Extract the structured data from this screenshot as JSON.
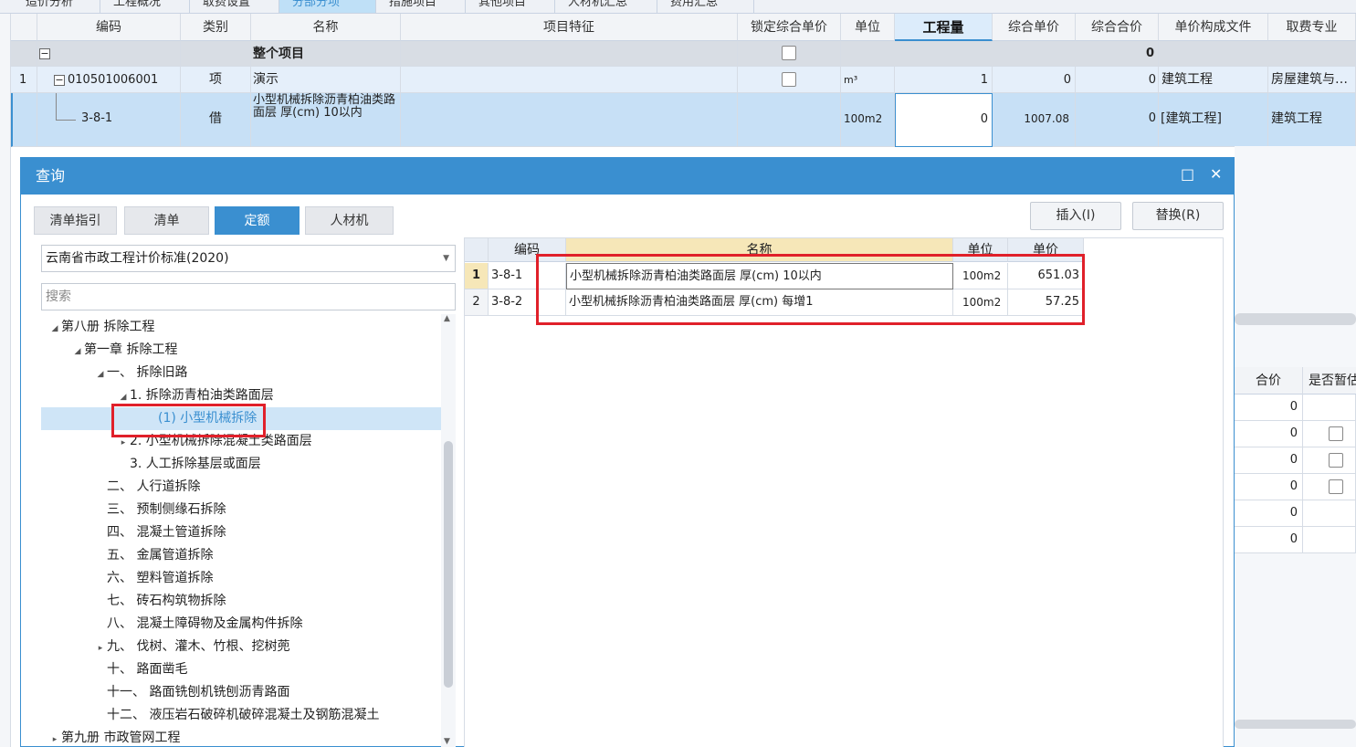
{
  "top_tabs": [
    "造价分析",
    "工程概况",
    "取费设置",
    "分部分项",
    "措施项目",
    "其他项目",
    "人材机汇总",
    "费用汇总"
  ],
  "grid": {
    "headers": [
      "编码",
      "类别",
      "名称",
      "项目特征",
      "锁定综合单价",
      "单位",
      "工程量",
      "综合单价",
      "综合合价",
      "单价构成文件",
      "取费专业"
    ],
    "row0": {
      "name": "整个项目",
      "total": "0",
      "expand": "−"
    },
    "row1": {
      "num": "1",
      "code": "010501006001",
      "type": "项",
      "name": "演示",
      "unit": "m³",
      "qty": "1",
      "price": "0",
      "total": "0",
      "file": "建筑工程",
      "fee": "房屋建筑与…",
      "expand": "−"
    },
    "row2": {
      "code": "3-8-1",
      "type": "借",
      "name": "小型机械拆除沥青柏油类路面层 厚(cm) 10以内",
      "unit": "100m2",
      "qty": "0",
      "price": "1007.08",
      "total": "0",
      "file": "[建筑工程]",
      "fee": "建筑工程"
    }
  },
  "right_panel": {
    "headers": [
      "合价",
      "是否暂估"
    ],
    "values": [
      "0",
      "0",
      "0",
      "0",
      "0",
      "0"
    ]
  },
  "dialog": {
    "title": "查询",
    "maximize_icon": "□",
    "close_icon": "✕",
    "tabs": [
      "清单指引",
      "清单",
      "定额",
      "人材机"
    ],
    "insert_label": "插入(I)",
    "replace_label": "替换(R)",
    "library": "云南省市政工程计价标准(2020)",
    "search_placeholder": "搜索",
    "tree": [
      {
        "label": "第八册 拆除工程",
        "arrow": "◢"
      },
      {
        "label": "第一章 拆除工程",
        "arrow": "◢"
      },
      {
        "label": "一、 拆除旧路",
        "arrow": "◢"
      },
      {
        "label": "1. 拆除沥青柏油类路面层",
        "arrow": "◢"
      },
      {
        "label": "(1) 小型机械拆除",
        "arrow": ""
      },
      {
        "label": "2. 小型机械拆除混凝土类路面层",
        "arrow": "▸"
      },
      {
        "label": "3. 人工拆除基层或面层",
        "arrow": ""
      },
      {
        "label": "二、 人行道拆除",
        "arrow": ""
      },
      {
        "label": "三、 预制侧缘石拆除",
        "arrow": ""
      },
      {
        "label": "四、 混凝土管道拆除",
        "arrow": ""
      },
      {
        "label": "五、 金属管道拆除",
        "arrow": ""
      },
      {
        "label": "六、 塑料管道拆除",
        "arrow": ""
      },
      {
        "label": "七、 砖石构筑物拆除",
        "arrow": ""
      },
      {
        "label": "八、 混凝土障碍物及金属构件拆除",
        "arrow": ""
      },
      {
        "label": "九、 伐树、灌木、竹根、挖树蔸",
        "arrow": "▸"
      },
      {
        "label": "十、 路面凿毛",
        "arrow": ""
      },
      {
        "label": "十一、 路面铣刨机铣刨沥青路面",
        "arrow": ""
      },
      {
        "label": "十二、 液压岩石破碎机破碎混凝土及钢筋混凝土",
        "arrow": ""
      },
      {
        "label": "第九册 市政管网工程",
        "arrow": "▸"
      }
    ],
    "result_headers": [
      "编码",
      "名称",
      "单位",
      "单价"
    ],
    "results": [
      {
        "num": "1",
        "code": "3-8-1",
        "name": "小型机械拆除沥青柏油类路面层 厚(cm) 10以内",
        "unit": "100m2",
        "price": "651.03"
      },
      {
        "num": "2",
        "code": "3-8-2",
        "name": "小型机械拆除沥青柏油类路面层 厚(cm) 每增1",
        "unit": "100m2",
        "price": "57.25"
      }
    ]
  },
  "colors": {
    "accent": "#3a8fd0",
    "highlight_red": "#e0202a",
    "selected_row": "#c7e0f6"
  }
}
